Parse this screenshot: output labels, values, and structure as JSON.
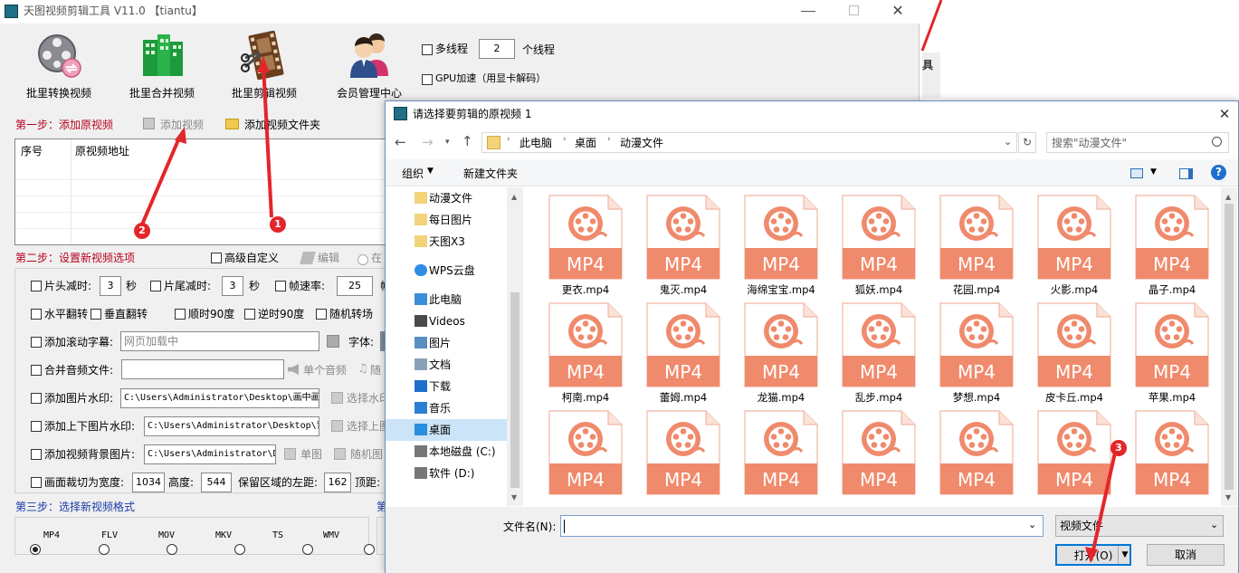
{
  "app": {
    "title": "天图视频剪辑工具 V11.0 【tiantu】",
    "toolbar": [
      {
        "label": "批里转换视频",
        "icon": "film-reel-convert-icon"
      },
      {
        "label": "批里合并视频",
        "icon": "green-building-merge-icon"
      },
      {
        "label": "批里剪辑视频",
        "icon": "film-strip-edit-icon"
      },
      {
        "label": "会员管理中心",
        "icon": "users-icon"
      }
    ],
    "multithread_label": "多线程",
    "thread_count": "2",
    "thread_unit": "个线程",
    "gpu_label": "GPU加速（用显卡解码）",
    "step1": {
      "title": "第一步：添加原视频",
      "add_video": "添加视频",
      "add_folder": "添加视频文件夹",
      "col_index": "序号",
      "col_path": "原视频地址"
    },
    "step2": {
      "title": "第二步：设置新视频选项",
      "advanced": "高级自定义",
      "edit": "编辑",
      "radio_partial": "在",
      "head_cut": "片头减时:",
      "head_val": "3",
      "sec1": "秒",
      "tail_cut": "片尾减时:",
      "tail_val": "3",
      "sec2": "秒",
      "fps": "帧速率:",
      "fps_val": "25",
      "fps_unit": "帧",
      "hflip": "水平翻转",
      "vflip": "垂直翻转",
      "cw90": "顺时90度",
      "ccw90": "逆时90度",
      "random_trans": "随机转场",
      "scroll_sub": "添加滚动字幕:",
      "scroll_val": "网页加载中",
      "font_label": "字体:",
      "merge_audio": "合并音频文件:",
      "single_audio": "单个音频",
      "random_partial": "随",
      "img_wm": "添加图片水印:",
      "img_wm_path": "C:\\Users\\Administrator\\Desktop\\画中画",
      "choose_wm": "选择水印",
      "tb_wm": "添加上下图片水印:",
      "tb_wm_path": "C:\\Users\\Administrator\\Desktop\\背",
      "choose_top": "选择上图",
      "bg_img": "添加视频背景图片:",
      "bg_img_path": "C:\\Users\\Administrator\\D",
      "single_img": "单图",
      "random_img": "随机图",
      "crop": "画面裁切为宽度:",
      "crop_w": "1034",
      "height": "高度:",
      "crop_h": "544",
      "keep_left": "保留区域的左距:",
      "left_val": "162",
      "top_label": "顶距:"
    },
    "step3": {
      "title": "第三步：选择新视频格式",
      "partial": "第",
      "formats": [
        "MP4",
        "FLV",
        "MOV",
        "MKV",
        "TS",
        "WMV"
      ],
      "selected": "MP4"
    },
    "right_strip_char": "具"
  },
  "dialog": {
    "title": "请选择要剪辑的原视频 1",
    "breadcrumb": [
      "此电脑",
      "桌面",
      "动漫文件"
    ],
    "search_placeholder": "搜索\"动漫文件\"",
    "organize": "组织",
    "new_folder": "新建文件夹",
    "help": "?",
    "nav": [
      {
        "label": "动漫文件",
        "icon": "folder-icon"
      },
      {
        "label": "每日图片",
        "icon": "folder-icon"
      },
      {
        "label": "天图X3",
        "icon": "folder-icon"
      },
      {
        "label": "WPS云盘",
        "icon": "cloud-icon"
      },
      {
        "label": "此电脑",
        "icon": "computer-icon"
      },
      {
        "label": "Videos",
        "icon": "video-folder-icon"
      },
      {
        "label": "图片",
        "icon": "pictures-icon"
      },
      {
        "label": "文档",
        "icon": "documents-icon"
      },
      {
        "label": "下载",
        "icon": "download-icon"
      },
      {
        "label": "音乐",
        "icon": "music-icon"
      },
      {
        "label": "桌面",
        "icon": "desktop-icon"
      },
      {
        "label": "本地磁盘 (C:)",
        "icon": "drive-icon"
      },
      {
        "label": "软件 (D:)",
        "icon": "drive-icon"
      }
    ],
    "file_badge": "MP4",
    "files": [
      "更衣.mp4",
      "鬼灭.mp4",
      "海绵宝宝.mp4",
      "狐妖.mp4",
      "花园.mp4",
      "火影.mp4",
      "晶子.mp4",
      "柯南.mp4",
      "蕾姆.mp4",
      "龙猫.mp4",
      "乱步.mp4",
      "梦想.mp4",
      "皮卡丘.mp4",
      "苹果.mp4",
      "",
      "",
      "",
      "",
      "",
      "",
      ""
    ],
    "filename_label": "文件名(N):",
    "filetype": "视频文件",
    "open": "打开(O)",
    "cancel": "取消"
  },
  "markers": [
    "1",
    "2",
    "3"
  ],
  "colors": {
    "accent_red": "#e3262b",
    "mp4_orange": "#f08a6c",
    "step_red": "#b8001e",
    "step_blue": "#1a3aa8",
    "selection": "#cce4f7"
  }
}
